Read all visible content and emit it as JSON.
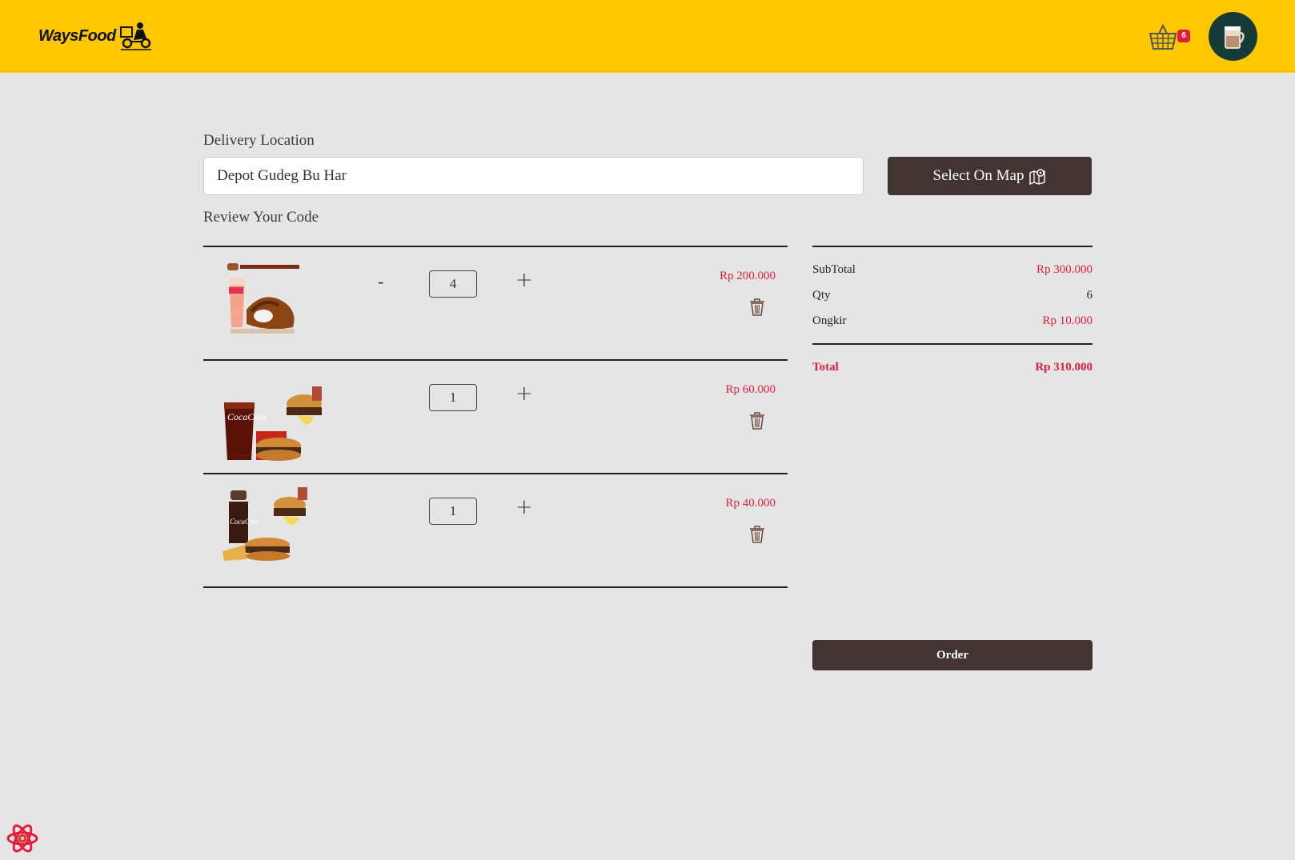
{
  "navbar": {
    "brand": "WaysFood",
    "cart_count": "6",
    "brand_color": "#ffc700"
  },
  "delivery": {
    "label": "Delivery Location",
    "location_value": "Depot Gudeg Bu Har",
    "map_button": "Select On Map"
  },
  "review": {
    "label": "Review Your Code"
  },
  "items": [
    {
      "qty": "4",
      "minus": "-",
      "plus": "+",
      "price": "Rp 200.000",
      "image": "chicken-burger-drink-promo"
    },
    {
      "qty": "1",
      "plus": "+",
      "price": "Rp 60.000",
      "image": "coca-cola-burger-combo"
    },
    {
      "qty": "1",
      "plus": "+",
      "price": "Rp 40.000",
      "image": "cola-bottle-burger-combo"
    }
  ],
  "summary": {
    "subtotal_label": "SubTotal",
    "subtotal_value": "Rp 300.000",
    "qty_label": "Qty",
    "qty_value": "6",
    "ongkir_label": "Ongkir",
    "ongkir_value": "Rp 10.000",
    "total_label": "Total",
    "total_value": "Rp 310.000"
  },
  "order_button": "Order",
  "colors": {
    "accent": "#433434",
    "price_red": "#e31d3c",
    "background": "#e5e5e5"
  }
}
